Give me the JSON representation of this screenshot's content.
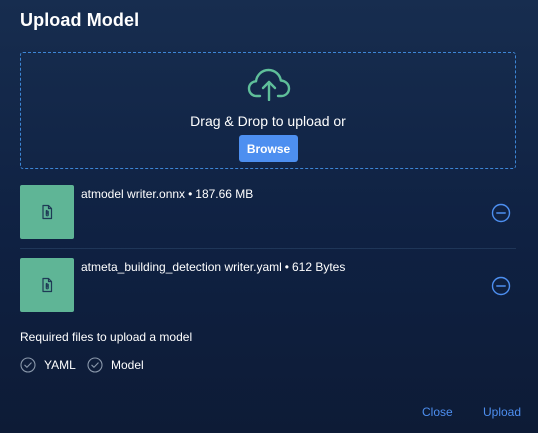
{
  "dialog": {
    "title": "Upload Model"
  },
  "dropzone": {
    "cloud_icon": "cloud-upload-icon",
    "text": "Drag & Drop to upload or",
    "browse_label": "Browse"
  },
  "files": [
    {
      "name": "atmodel writer.onnx",
      "size": "187.66 MB",
      "icon": "attachment-file-icon",
      "remove_icon": "minus-circle-icon"
    },
    {
      "name": "atmeta_building_detection writer.yaml",
      "size": "612 Bytes",
      "icon": "attachment-file-icon",
      "remove_icon": "minus-circle-icon"
    }
  ],
  "separator": "•",
  "requirements": {
    "label": "Required files to upload a model",
    "items": [
      {
        "label": "YAML",
        "icon": "check-circle-icon"
      },
      {
        "label": "Model",
        "icon": "check-circle-icon"
      }
    ]
  },
  "footer": {
    "close_label": "Close",
    "upload_label": "Upload"
  },
  "colors": {
    "accent": "#4d8ff0",
    "file_thumb": "#5fb596",
    "cloud_icon": "#5fbf9a",
    "dropzone_border": "#3d86d6",
    "background": "#0f2142"
  }
}
